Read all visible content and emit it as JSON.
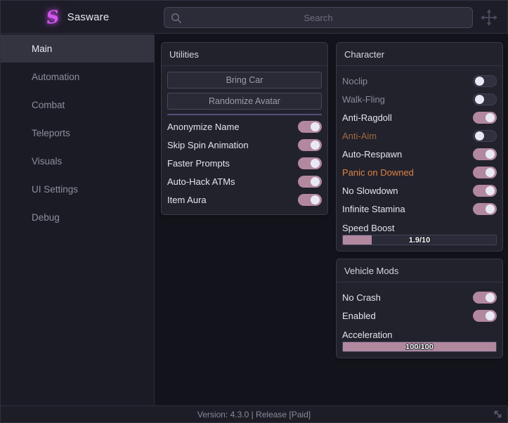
{
  "header": {
    "logo_glyph": "S",
    "brand": "Sasware",
    "search": {
      "placeholder": "Search"
    }
  },
  "sidebar": {
    "items": [
      {
        "label": "Main",
        "active": true
      },
      {
        "label": "Automation",
        "active": false
      },
      {
        "label": "Combat",
        "active": false
      },
      {
        "label": "Teleports",
        "active": false
      },
      {
        "label": "Visuals",
        "active": false
      },
      {
        "label": "UI Settings",
        "active": false
      },
      {
        "label": "Debug",
        "active": false
      }
    ]
  },
  "panels": {
    "utilities": {
      "title": "Utilities",
      "buttons": [
        "Bring Car",
        "Randomize Avatar"
      ],
      "toggles": [
        {
          "label": "Anonymize Name",
          "on": true
        },
        {
          "label": "Skip Spin Animation",
          "on": true
        },
        {
          "label": "Faster Prompts",
          "on": true
        },
        {
          "label": "Auto-Hack ATMs",
          "on": true
        },
        {
          "label": "Item Aura",
          "on": true
        }
      ]
    },
    "character": {
      "title": "Character",
      "toggles": [
        {
          "label": "Noclip",
          "on": false
        },
        {
          "label": "Walk-Fling",
          "on": false
        },
        {
          "label": "Anti-Ragdoll",
          "on": true
        },
        {
          "label": "Anti-Aim",
          "on": false,
          "accent": "orange"
        },
        {
          "label": "Auto-Respawn",
          "on": true
        },
        {
          "label": "Panic on Downed",
          "on": true,
          "accent": "orange"
        },
        {
          "label": "No Slowdown",
          "on": true
        },
        {
          "label": "Infinite Stamina",
          "on": true
        }
      ],
      "slider": {
        "label": "Speed Boost",
        "value_text": "1.9/10",
        "percent": 19
      }
    },
    "vehicle_mods": {
      "title": "Vehicle Mods",
      "toggles": [
        {
          "label": "No Crash",
          "on": true
        },
        {
          "label": "Enabled",
          "on": true
        }
      ],
      "slider": {
        "label": "Acceleration",
        "value_text": "100/100",
        "percent": 100
      }
    }
  },
  "statusbar": {
    "text": "Version: 4.3.0 | Release [Paid]"
  },
  "icons": {
    "search": "magnifier-icon",
    "move": "move-cross-icon",
    "resize": "diagonal-resize-icon"
  },
  "colors": {
    "toggle_on": "#b2889f",
    "accent_orange": "#dd8244",
    "accent_orange_dim": "#a0693f",
    "logo_magenta": "#d356ee",
    "panel_bg": "#22222c",
    "sidebar_active_bg": "#343440",
    "separator": "#52507a"
  }
}
